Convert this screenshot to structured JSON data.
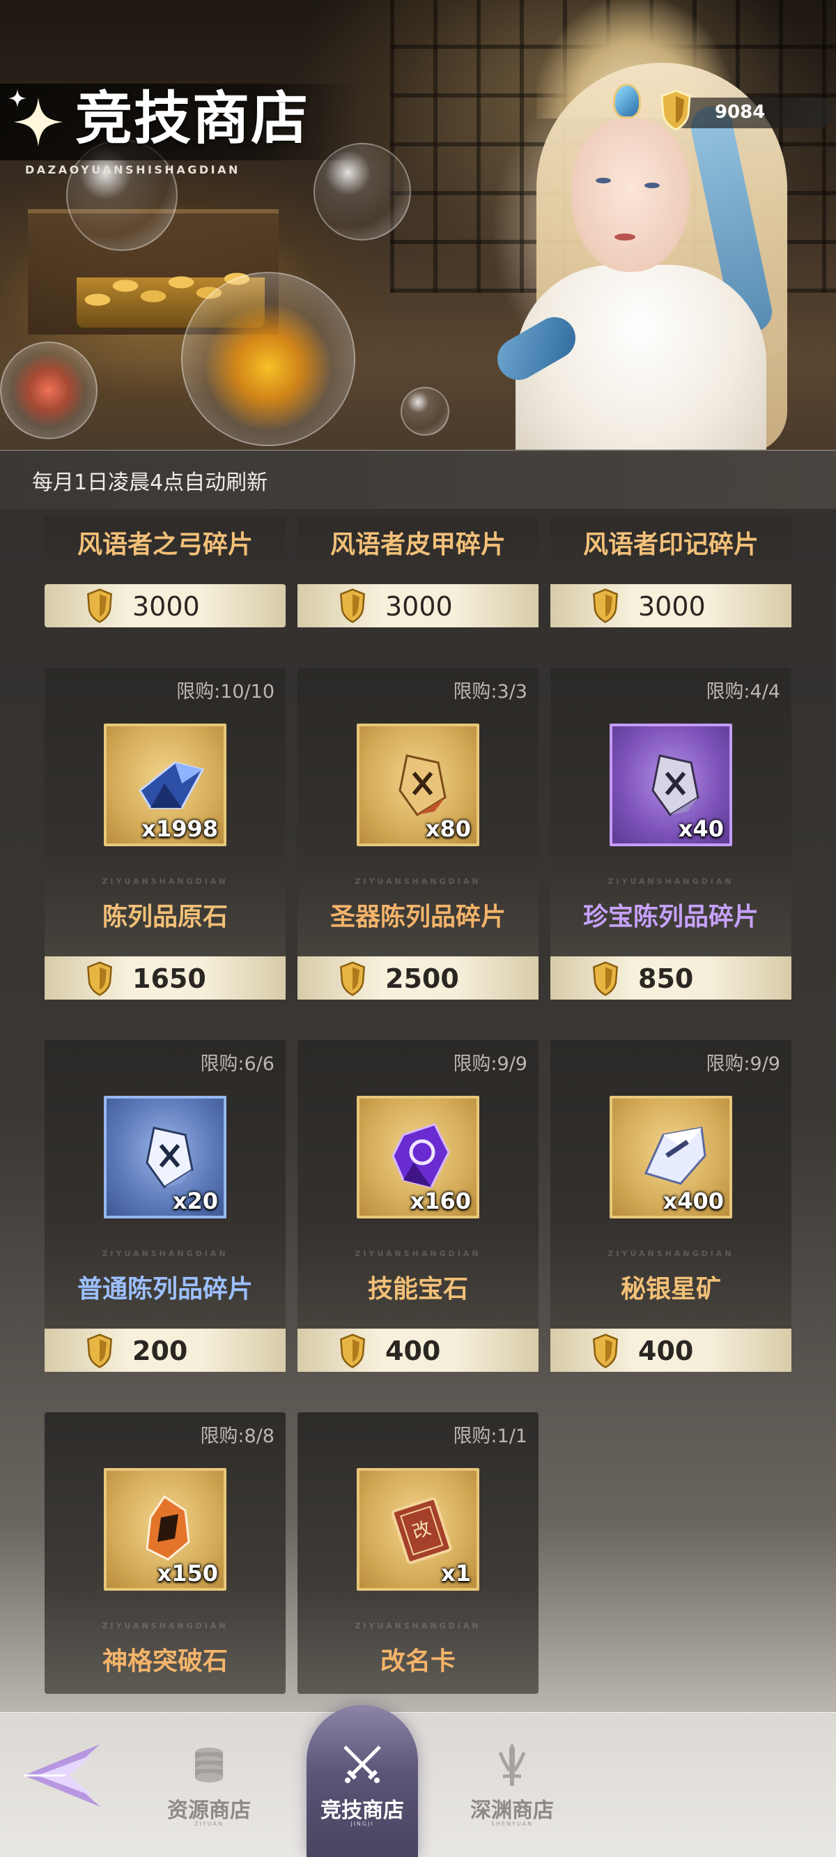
{
  "header": {
    "title": "竞技商店",
    "title_sub": "DAZAOYUANSHISHAGDIAN",
    "currency_value": "9084",
    "refresh_note": "每月1日凌晨4点自动刷新"
  },
  "top_items": [
    {
      "name": "风语者之弓碎片",
      "price": "3000"
    },
    {
      "name": "风语者皮甲碎片",
      "price": "3000"
    },
    {
      "name": "风语者印记碎片",
      "price": "3000"
    }
  ],
  "items": [
    {
      "name": "陈列品原石",
      "limit": "限购:10/10",
      "qty": "x1998",
      "price": "1650",
      "watermark": "ZIYUANSHANGDIAN"
    },
    {
      "name": "圣器陈列品碎片",
      "limit": "限购:3/3",
      "qty": "x80",
      "price": "2500",
      "watermark": "ZIYUANSHANGDIAN"
    },
    {
      "name": "珍宝陈列品碎片",
      "limit": "限购:4/4",
      "qty": "x40",
      "price": "850",
      "watermark": "ZIYUANSHANGDIAN"
    },
    {
      "name": "普通陈列品碎片",
      "limit": "限购:6/6",
      "qty": "x20",
      "price": "200",
      "watermark": "ZIYUANSHANGDIAN"
    },
    {
      "name": "技能宝石",
      "limit": "限购:9/9",
      "qty": "x160",
      "price": "400",
      "watermark": "ZIYUANSHANGDIAN"
    },
    {
      "name": "秘银星矿",
      "limit": "限购:9/9",
      "qty": "x400",
      "price": "400",
      "watermark": "ZIYUANSHANGDIAN"
    },
    {
      "name": "神格突破石",
      "limit": "限购:8/8",
      "qty": "x150",
      "price": "",
      "watermark": "ZIYUANSHANGDIAN"
    },
    {
      "name": "改名卡",
      "limit": "限购:1/1",
      "qty": "x1",
      "price": "",
      "watermark": "ZIYUANSHANGDIAN"
    }
  ],
  "nav": {
    "tabs": [
      {
        "label": "资源商店",
        "sub": "ZIYUAN"
      },
      {
        "label": "竞技商店",
        "sub": "JINGJI"
      },
      {
        "label": "深渊商店",
        "sub": "SHENYUAN"
      }
    ],
    "active_index": 1
  },
  "colors": {
    "gold_name": "#f2c078",
    "orange_name": "#f4b46a",
    "purple_name": "#c7a2ff",
    "blue_name": "#9cc0ff",
    "price_text": "#2a2622"
  }
}
